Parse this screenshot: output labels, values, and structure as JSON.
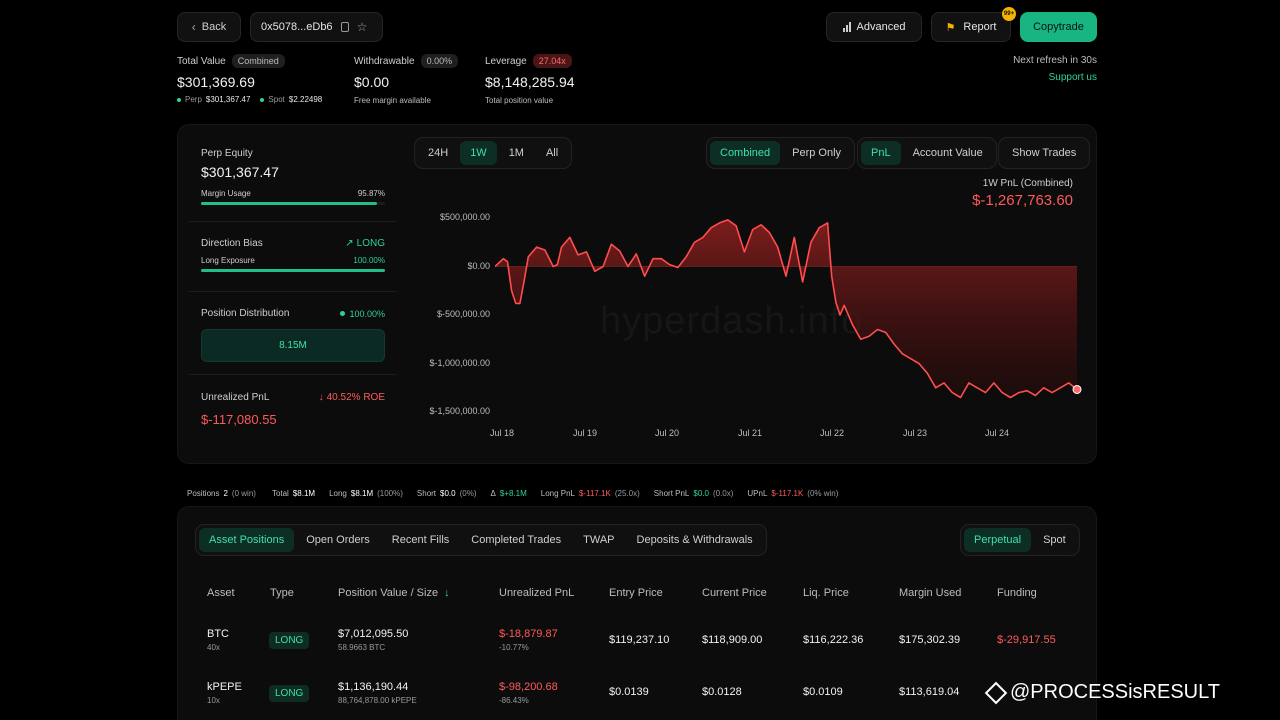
{
  "header": {
    "back_label": "Back",
    "address": "0x5078...eDb6",
    "advanced_label": "Advanced",
    "report_label": "Report",
    "report_badge": "99+",
    "copytrade_label": "Copytrade",
    "refresh_text": "Next refresh in 30s",
    "support_text": "Support us"
  },
  "summary": {
    "total_value_label": "Total Value",
    "total_value_pill": "Combined",
    "total_value": "$301,369.69",
    "perp_label": "Perp",
    "perp_value": "$301,367.47",
    "spot_label": "Spot",
    "spot_value": "$2.22498",
    "withdrawable_label": "Withdrawable",
    "withdrawable_pill": "0.00%",
    "withdrawable_value": "$0.00",
    "withdrawable_sub": "Free margin available",
    "leverage_label": "Leverage",
    "leverage_pill": "27.04x",
    "leverage_value": "$8,148,285.94",
    "leverage_sub": "Total position value"
  },
  "left_panel": {
    "perp_equity_label": "Perp Equity",
    "perp_equity_value": "$301,367.47",
    "margin_usage_label": "Margin Usage",
    "margin_usage_value": "95.87%",
    "margin_usage_fraction": 0.9587,
    "direction_bias_label": "Direction Bias",
    "direction_bias_value": "LONG",
    "long_exposure_label": "Long Exposure",
    "long_exposure_value": "100.00%",
    "long_exposure_fraction": 1.0,
    "position_distribution_label": "Position Distribution",
    "position_distribution_value": "100.00%",
    "distribution_bar_label": "8.15M",
    "unrealized_pnl_label": "Unrealized PnL",
    "roe_value": "40.52% ROE",
    "unrealized_pnl_value": "$-117,080.55"
  },
  "chart_controls": {
    "ranges": [
      "24H",
      "1W",
      "1M",
      "All"
    ],
    "active_range": "1W",
    "modes": [
      "Combined",
      "Perp Only"
    ],
    "active_mode": "Combined",
    "metrics": [
      "PnL",
      "Account Value"
    ],
    "active_metric": "PnL",
    "show_trades_label": "Show Trades"
  },
  "chart_header": {
    "caption": "1W PnL (Combined)",
    "value": "$-1,267,763.60",
    "watermark": "hyperdash.info"
  },
  "chart_data": {
    "type": "area",
    "title": "1W PnL (Combined)",
    "y_ticks": [
      "$500,000.00",
      "$0.00",
      "$-500,000.00",
      "$-1,000,000.00",
      "$-1,500,000.00"
    ],
    "x_ticks": [
      "Jul 18",
      "Jul 19",
      "Jul 20",
      "Jul 21",
      "Jul 22",
      "Jul 23",
      "Jul 24"
    ],
    "ylim": [
      -1500000,
      500000
    ],
    "xlim": [
      0,
      7
    ],
    "colors": {
      "line": "#ff4d4d",
      "fill": "#7a1a1a"
    },
    "x": [
      0,
      0.1,
      0.15,
      0.2,
      0.25,
      0.3,
      0.35,
      0.4,
      0.5,
      0.6,
      0.7,
      0.75,
      0.8,
      0.9,
      1.0,
      1.1,
      1.2,
      1.3,
      1.4,
      1.5,
      1.6,
      1.7,
      1.8,
      1.9,
      2.0,
      2.1,
      2.2,
      2.3,
      2.4,
      2.5,
      2.6,
      2.7,
      2.8,
      2.9,
      3.0,
      3.1,
      3.2,
      3.3,
      3.4,
      3.5,
      3.6,
      3.7,
      3.8,
      3.9,
      4.0,
      4.05,
      4.1,
      4.15,
      4.2,
      4.3,
      4.4,
      4.5,
      4.6,
      4.7,
      4.8,
      4.9,
      5.0,
      5.1,
      5.2,
      5.3,
      5.4,
      5.5,
      5.6,
      5.7,
      5.8,
      5.9,
      6.0,
      6.1,
      6.2,
      6.3,
      6.4,
      6.5,
      6.6,
      6.7,
      6.8,
      6.9,
      7.0
    ],
    "y": [
      0,
      80000,
      50000,
      -250000,
      -380000,
      -380000,
      -150000,
      100000,
      200000,
      170000,
      0,
      20000,
      200000,
      300000,
      120000,
      150000,
      -50000,
      0,
      230000,
      160000,
      0,
      130000,
      -100000,
      80000,
      80000,
      20000,
      -10000,
      100000,
      250000,
      300000,
      400000,
      450000,
      480000,
      420000,
      150000,
      380000,
      430000,
      350000,
      200000,
      -100000,
      300000,
      -160000,
      250000,
      400000,
      450000,
      -100000,
      -370000,
      -500000,
      -400000,
      -600000,
      -750000,
      -720000,
      -650000,
      -680000,
      -800000,
      -900000,
      -950000,
      -1000000,
      -1100000,
      -1250000,
      -1200000,
      -1300000,
      -1350000,
      -1200000,
      -1250000,
      -1300000,
      -1200000,
      -1300000,
      -1350000,
      -1300000,
      -1280000,
      -1330000,
      -1250000,
      -1300000,
      -1250000,
      -1200000,
      -1267763
    ]
  },
  "stats_strip": {
    "positions_label": "Positions",
    "positions_value": "2",
    "positions_win": "(0 win)",
    "total_label": "Total",
    "total_value": "$8.1M",
    "long_label": "Long",
    "long_value": "$8.1M",
    "long_pct": "(100%)",
    "short_label": "Short",
    "short_value": "$0.0",
    "short_pct": "(0%)",
    "delta_label": "Δ",
    "delta_value": "$+8.1M",
    "long_pnl_label": "Long PnL",
    "long_pnl_value": "$-117.1K",
    "long_pnl_x": "(25.0x)",
    "short_pnl_label": "Short PnL",
    "short_pnl_value": "$0.0",
    "short_pnl_x": "(0.0x)",
    "upnl_label": "UPnL",
    "upnl_value": "$-117.1K",
    "upnl_win": "(0% win)"
  },
  "table_tabs": {
    "tabs": [
      "Asset Positions",
      "Open Orders",
      "Recent Fills",
      "Completed Trades",
      "TWAP",
      "Deposits & Withdrawals"
    ],
    "active_tab": "Asset Positions",
    "market_tabs": [
      "Perpetual",
      "Spot"
    ],
    "active_market": "Perpetual"
  },
  "table": {
    "headers": [
      "Asset",
      "Type",
      "Position Value / Size",
      "Unrealized PnL",
      "Entry Price",
      "Current Price",
      "Liq. Price",
      "Margin Used",
      "Funding"
    ],
    "sort_arrow": "↓",
    "rows": [
      {
        "asset": "BTC",
        "leverage": "40x",
        "type": "LONG",
        "position_value": "$7,012,095.50",
        "size": "58.9663 BTC",
        "upnl": "$-18,879.87",
        "upnl_pct": "-10.77%",
        "entry": "$119,237.10",
        "current": "$118,909.00",
        "liq": "$116,222.36",
        "margin": "$175,302.39",
        "funding": "$-29,917.55"
      },
      {
        "asset": "kPEPE",
        "leverage": "10x",
        "type": "LONG",
        "position_value": "$1,136,190.44",
        "size": "88,764,878.00 kPEPE",
        "upnl": "$-98,200.68",
        "upnl_pct": "-86.43%",
        "entry": "$0.0139",
        "current": "$0.0128",
        "liq": "$0.0109",
        "margin": "$113,619.04",
        "funding": ""
      }
    ]
  },
  "overlay_watermark": "@PROCESSisRESULT"
}
